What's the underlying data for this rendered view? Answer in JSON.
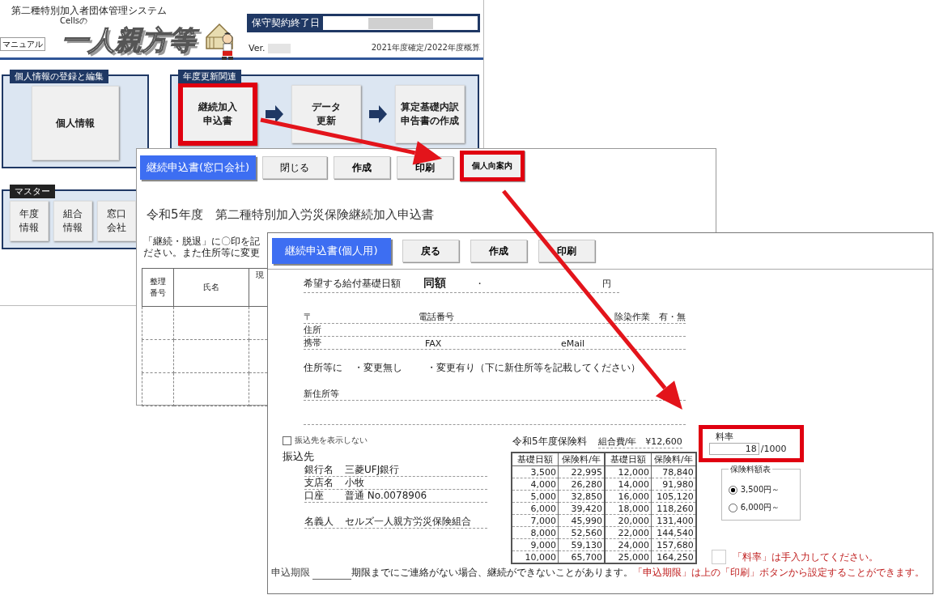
{
  "header": {
    "system_name": "第二種特別加入者団体管理システム",
    "brand_prefix": "Cellsの",
    "brand_title": "一人親方等",
    "manual_button": "マニュアル",
    "maintenance_label": "保守契約終了日",
    "version_label": "Ver.",
    "fiscal_note": "2021年度確定/2022年度概算"
  },
  "menu_groups": [
    {
      "title": "個人情報の登録と編集",
      "kind": "large",
      "buttons": [
        {
          "lines": [
            "個人情報"
          ],
          "highlighted": false
        }
      ]
    },
    {
      "title": "年度更新関連",
      "kind": "flow",
      "buttons": [
        {
          "lines": [
            "継続加入",
            "申込書"
          ],
          "highlighted": true
        },
        {
          "lines": [
            "データ",
            "更新"
          ],
          "highlighted": false
        },
        {
          "lines": [
            "算定基礎内訳",
            "申告書の作成"
          ],
          "highlighted": false
        }
      ]
    },
    {
      "title": "マスター",
      "kind": "small",
      "buttons": [
        {
          "lines": [
            "年度",
            "情報"
          ],
          "highlighted": false
        },
        {
          "lines": [
            "組合",
            "情報"
          ],
          "highlighted": false
        },
        {
          "lines": [
            "窓口",
            "会社"
          ],
          "highlighted": false
        }
      ]
    }
  ],
  "company_window": {
    "title": "継続申込書(窓口会社)",
    "buttons": [
      {
        "label": "閉じる",
        "highlighted": false
      },
      {
        "label": "作成",
        "highlighted": false
      },
      {
        "label": "印刷",
        "highlighted": false
      },
      {
        "label": "個人向案内",
        "highlighted": true
      }
    ],
    "heading": "令和5年度　第二種特別加入労災保険継続加入申込書",
    "instructions": [
      "「継続・脱退」に〇印を記",
      "ださい。また住所等に変更"
    ],
    "table": {
      "columns": [
        [
          "整理",
          "番号"
        ],
        [
          "氏名"
        ],
        [
          "現"
        ]
      ]
    }
  },
  "personal_window": {
    "title": "継続申込書(個人用)",
    "buttons": [
      {
        "label": "戻る"
      },
      {
        "label": "作成"
      },
      {
        "label": "印刷"
      }
    ],
    "benefit": {
      "label": "希望する給付基礎日額",
      "value": "同額",
      "separator": "・",
      "unit": "円"
    },
    "form_lines": [
      {
        "kind": "contact",
        "cells": [
          "〒",
          "電話番号",
          "除染作業　有・無"
        ]
      },
      {
        "kind": "single",
        "cells": [
          "住所"
        ]
      },
      {
        "kind": "mobile",
        "cells": [
          "携帯",
          "FAX",
          "eMail"
        ]
      },
      {
        "kind": "change",
        "cells": [
          "住所等に",
          "・変更無し",
          "・変更有り（下に新住所等を記載してください）"
        ]
      },
      {
        "kind": "single",
        "cells": [
          "新住所等"
        ]
      },
      {
        "kind": "blank"
      }
    ],
    "hide_transfer": {
      "label": "振込先を表示しない",
      "checked": false
    },
    "transfer": {
      "title": "振込先",
      "rows": [
        {
          "label": "銀行名",
          "value": "三菱UFJ銀行"
        },
        {
          "label": "支店名",
          "value": "小牧"
        },
        {
          "label": "口座",
          "value": "普通 No.0078906"
        }
      ],
      "holder": {
        "label": "名義人",
        "value": "セルズ一人親方労災保険組合"
      }
    },
    "premium": {
      "title": "令和5年度保険料",
      "union_fee": "組合費/年　¥12,600",
      "columns": [
        "基礎日額",
        "保険料/年",
        "基礎日額",
        "保険料/年"
      ],
      "rows": [
        [
          "3,500",
          "22,995",
          "12,000",
          "78,840"
        ],
        [
          "4,000",
          "26,280",
          "14,000",
          "91,980"
        ],
        [
          "5,000",
          "32,850",
          "16,000",
          "105,120"
        ],
        [
          "6,000",
          "39,420",
          "18,000",
          "118,260"
        ],
        [
          "7,000",
          "45,990",
          "20,000",
          "131,400"
        ],
        [
          "8,000",
          "52,560",
          "22,000",
          "144,540"
        ],
        [
          "9,000",
          "59,130",
          "24,000",
          "157,680"
        ],
        [
          "10,000",
          "65,700",
          "25,000",
          "164,250"
        ]
      ]
    },
    "rate": {
      "label": "料率",
      "value": "18",
      "suffix": "/1000",
      "highlighted": true
    },
    "table_choice": {
      "title": "保険料額表",
      "options": [
        {
          "label": "3,500円～",
          "selected": true
        },
        {
          "label": "6,000円～",
          "selected": false
        }
      ]
    },
    "rate_note": "「料率」は手入力してください。",
    "deadline": {
      "label": "申込期限",
      "note": "期限までにご連絡がない場合、継続ができないことがあります。",
      "warning": "「申込期限」は上の「印刷」ボタンから設定することができます。"
    }
  }
}
